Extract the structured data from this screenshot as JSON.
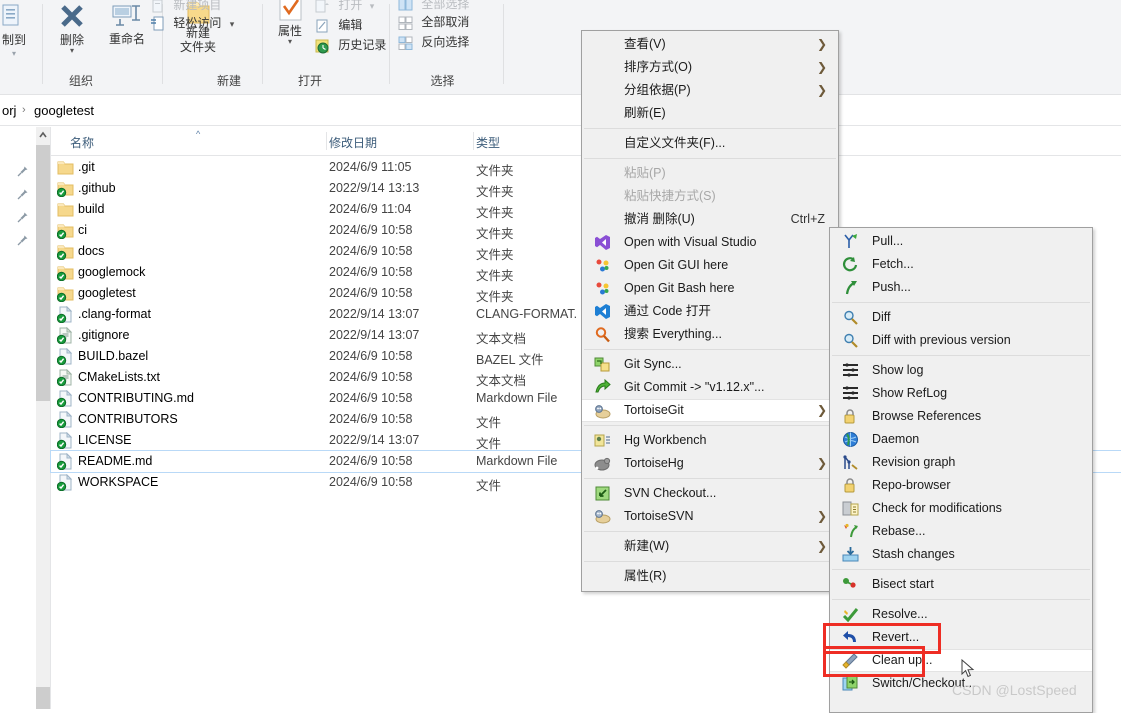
{
  "ribbon": {
    "groups": [
      {
        "label": "组织"
      },
      {
        "label": "新建"
      },
      {
        "label": "打开"
      },
      {
        "label": "选择"
      }
    ],
    "organize": {
      "copy_to_label": "制到",
      "delete_label": "删除",
      "rename_label": "重命名"
    },
    "new_group": {
      "new_folder_label_line1": "新建",
      "new_folder_label_line2": "文件夹",
      "new_item_label": "新建项目",
      "easy_access_label": "轻松访问"
    },
    "open_group": {
      "open_label": "打开",
      "edit_label": "编辑",
      "history_label": "历史记录",
      "properties_label": "属性"
    },
    "select_group": {
      "select_all_label": "全部选择",
      "select_none_label": "全部取消",
      "invert_label": "反向选择"
    }
  },
  "address": {
    "crumb1": "orj",
    "separator": "›",
    "crumb2": "googletest"
  },
  "filelist": {
    "columns": [
      {
        "key": "name",
        "label": "名称"
      },
      {
        "key": "date",
        "label": "修改日期"
      },
      {
        "key": "type",
        "label": "类型"
      }
    ],
    "sort_indicator": "^",
    "rows": [
      {
        "name": ".git",
        "date": "2024/6/9 11:05",
        "type": "文件夹",
        "icon": "folder-plain-icon",
        "selected": false
      },
      {
        "name": ".github",
        "date": "2022/9/14 13:13",
        "type": "文件夹",
        "icon": "folder-git-ok-icon",
        "selected": false
      },
      {
        "name": "build",
        "date": "2024/6/9 11:04",
        "type": "文件夹",
        "icon": "folder-plain-icon",
        "selected": false
      },
      {
        "name": "ci",
        "date": "2024/6/9 10:58",
        "type": "文件夹",
        "icon": "folder-git-ok-icon",
        "selected": false
      },
      {
        "name": "docs",
        "date": "2024/6/9 10:58",
        "type": "文件夹",
        "icon": "folder-git-ok-icon",
        "selected": false
      },
      {
        "name": "googlemock",
        "date": "2024/6/9 10:58",
        "type": "文件夹",
        "icon": "folder-git-ok-icon",
        "selected": false
      },
      {
        "name": "googletest",
        "date": "2024/6/9 10:58",
        "type": "文件夹",
        "icon": "folder-git-ok-icon",
        "selected": false
      },
      {
        "name": ".clang-format",
        "date": "2022/9/14 13:07",
        "type": "CLANG-FORMAT.",
        "icon": "file-git-ok-icon",
        "selected": false
      },
      {
        "name": ".gitignore",
        "date": "2022/9/14 13:07",
        "type": "文本文档",
        "icon": "textfile-git-ok-icon",
        "selected": false
      },
      {
        "name": "BUILD.bazel",
        "date": "2024/6/9 10:58",
        "type": "BAZEL 文件",
        "icon": "file-git-ok-icon",
        "selected": false
      },
      {
        "name": "CMakeLists.txt",
        "date": "2024/6/9 10:58",
        "type": "文本文档",
        "icon": "textfile-git-ok-icon",
        "selected": false
      },
      {
        "name": "CONTRIBUTING.md",
        "date": "2024/6/9 10:58",
        "type": "Markdown File",
        "icon": "file-git-ok-icon",
        "selected": false
      },
      {
        "name": "CONTRIBUTORS",
        "date": "2024/6/9 10:58",
        "type": "文件",
        "icon": "file-git-ok-icon",
        "selected": false
      },
      {
        "name": "LICENSE",
        "date": "2022/9/14 13:07",
        "type": "文件",
        "icon": "file-git-ok-icon",
        "selected": false
      },
      {
        "name": "README.md",
        "date": "2024/6/9 10:58",
        "type": "Markdown File",
        "icon": "file-git-ok-icon",
        "selected": true
      },
      {
        "name": "WORKSPACE",
        "date": "2024/6/9 10:58",
        "type": "文件",
        "icon": "file-git-ok-icon",
        "selected": false
      }
    ]
  },
  "context_menu": {
    "items": [
      {
        "label": "查看(V)",
        "arrow": true,
        "icon": null,
        "disabled": false,
        "sep_after": false
      },
      {
        "label": "排序方式(O)",
        "arrow": true,
        "icon": null,
        "disabled": false,
        "sep_after": false
      },
      {
        "label": "分组依据(P)",
        "arrow": true,
        "icon": null,
        "disabled": false,
        "sep_after": false
      },
      {
        "label": "刷新(E)",
        "arrow": false,
        "icon": null,
        "disabled": false,
        "sep_after": true
      },
      {
        "label": "自定义文件夹(F)...",
        "arrow": false,
        "icon": null,
        "disabled": false,
        "sep_after": true
      },
      {
        "label": "粘贴(P)",
        "arrow": false,
        "icon": null,
        "disabled": true,
        "sep_after": false
      },
      {
        "label": "粘贴快捷方式(S)",
        "arrow": false,
        "icon": null,
        "disabled": true,
        "sep_after": false
      },
      {
        "label": "撤消 删除(U)",
        "arrow": false,
        "icon": null,
        "disabled": false,
        "accel": "Ctrl+Z",
        "sep_after": false
      },
      {
        "label": "Open with Visual Studio",
        "arrow": false,
        "icon": "visual-studio-icon",
        "disabled": false,
        "sep_after": false
      },
      {
        "label": "Open Git GUI here",
        "arrow": false,
        "icon": "git-gui-icon",
        "disabled": false,
        "sep_after": false
      },
      {
        "label": "Open Git Bash here",
        "arrow": false,
        "icon": "git-bash-icon",
        "disabled": false,
        "sep_after": false
      },
      {
        "label": "通过 Code 打开",
        "arrow": false,
        "icon": "vscode-icon",
        "disabled": false,
        "sep_after": false
      },
      {
        "label": "搜索 Everything...",
        "arrow": false,
        "icon": "everything-icon",
        "disabled": false,
        "sep_after": true
      },
      {
        "label": "Git Sync...",
        "arrow": false,
        "icon": "git-sync-icon",
        "disabled": false,
        "sep_after": false
      },
      {
        "label": "Git Commit -> \"v1.12.x\"...",
        "arrow": false,
        "icon": "git-commit-icon",
        "disabled": false,
        "sep_after": false
      },
      {
        "label": "TortoiseGit",
        "arrow": true,
        "icon": "tortoisegit-icon",
        "disabled": false,
        "hover": true,
        "sep_after": true
      },
      {
        "label": "Hg Workbench",
        "arrow": false,
        "icon": "hg-workbench-icon",
        "disabled": false,
        "sep_after": false
      },
      {
        "label": "TortoiseHg",
        "arrow": true,
        "icon": "tortoisehg-icon",
        "disabled": false,
        "sep_after": true
      },
      {
        "label": "SVN Checkout...",
        "arrow": false,
        "icon": "svn-checkout-icon",
        "disabled": false,
        "sep_after": false
      },
      {
        "label": "TortoiseSVN",
        "arrow": true,
        "icon": "tortoisesvn-icon",
        "disabled": false,
        "sep_after": true
      },
      {
        "label": "新建(W)",
        "arrow": true,
        "icon": null,
        "disabled": false,
        "sep_after": true
      },
      {
        "label": "属性(R)",
        "arrow": false,
        "icon": null,
        "disabled": false,
        "sep_after": false
      }
    ]
  },
  "submenu": {
    "items": [
      {
        "label": "Pull...",
        "icon": "pull-icon",
        "sep_after": false
      },
      {
        "label": "Fetch...",
        "icon": "fetch-icon",
        "sep_after": false
      },
      {
        "label": "Push...",
        "icon": "push-icon",
        "sep_after": true
      },
      {
        "label": "Diff",
        "icon": "diff-icon",
        "sep_after": false
      },
      {
        "label": "Diff with previous version",
        "icon": "diff-icon",
        "sep_after": true
      },
      {
        "label": "Show log",
        "icon": "log-icon",
        "sep_after": false
      },
      {
        "label": "Show RefLog",
        "icon": "log-icon",
        "sep_after": false
      },
      {
        "label": "Browse References",
        "icon": "lock-icon",
        "sep_after": false
      },
      {
        "label": "Daemon",
        "icon": "globe-icon",
        "sep_after": false
      },
      {
        "label": "Revision graph",
        "icon": "graph-icon",
        "sep_after": false
      },
      {
        "label": "Repo-browser",
        "icon": "lock-icon",
        "sep_after": false
      },
      {
        "label": "Check for modifications",
        "icon": "checkmod-icon",
        "sep_after": false
      },
      {
        "label": "Rebase...",
        "icon": "rebase-icon",
        "sep_after": false
      },
      {
        "label": "Stash changes",
        "icon": "stash-icon",
        "sep_after": true
      },
      {
        "label": "Bisect start",
        "icon": "bisect-icon",
        "sep_after": true
      },
      {
        "label": "Resolve...",
        "icon": "resolve-icon",
        "sep_after": false
      },
      {
        "label": "Revert...",
        "icon": "revert-icon",
        "highlight_box": true,
        "sep_after": false
      },
      {
        "label": "Clean up...",
        "icon": "cleanup-icon",
        "highlight_box": true,
        "hover": true,
        "sep_after": false
      },
      {
        "label": "Switch/Checkout...",
        "icon": "switch-icon",
        "sep_after": false
      }
    ]
  },
  "annotations": {
    "highlight_color": "#ee2d24"
  },
  "watermark": {
    "text": "CSDN @LostSpeed"
  }
}
